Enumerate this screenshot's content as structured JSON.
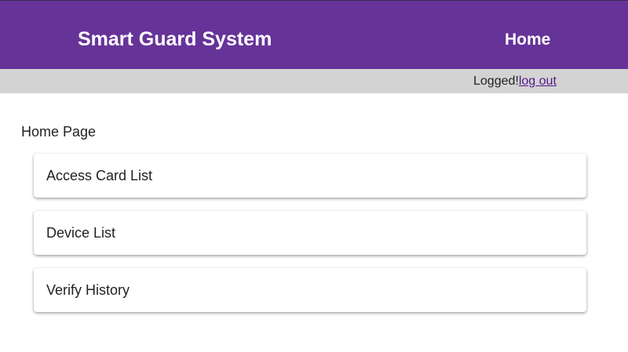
{
  "header": {
    "title": "Smart Guard System",
    "nav_home_label": "Home",
    "background_color": "#663399"
  },
  "status_bar": {
    "logged_text": "Logged!",
    "logout_label": "log out"
  },
  "main": {
    "page_title": "Home Page",
    "menu_items": [
      {
        "label": "Access Card List"
      },
      {
        "label": "Device List"
      },
      {
        "label": "Verify History"
      }
    ]
  }
}
